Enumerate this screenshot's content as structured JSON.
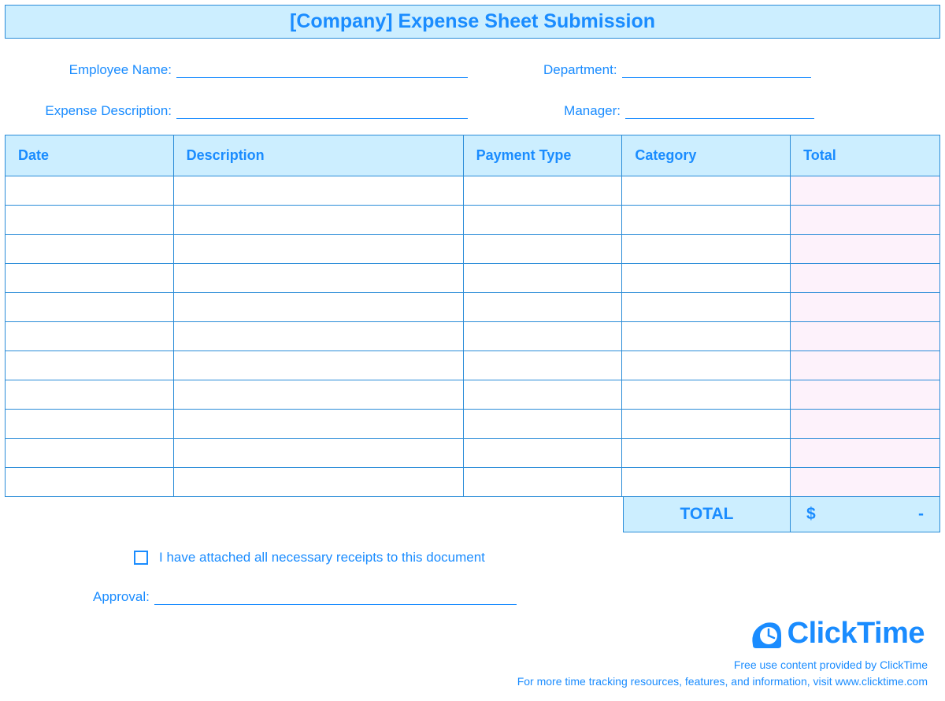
{
  "title": "[Company] Expense Sheet Submission",
  "info": {
    "employee_name_label": "Employee Name:",
    "employee_name_value": "",
    "department_label": "Department:",
    "department_value": "",
    "expense_desc_label": "Expense Description:",
    "expense_desc_value": "",
    "manager_label": "Manager:",
    "manager_value": ""
  },
  "columns": {
    "date": "Date",
    "description": "Description",
    "payment_type": "Payment Type",
    "category": "Category",
    "total": "Total"
  },
  "rows": [
    {
      "date": "",
      "description": "",
      "payment_type": "",
      "category": "",
      "total": ""
    },
    {
      "date": "",
      "description": "",
      "payment_type": "",
      "category": "",
      "total": ""
    },
    {
      "date": "",
      "description": "",
      "payment_type": "",
      "category": "",
      "total": ""
    },
    {
      "date": "",
      "description": "",
      "payment_type": "",
      "category": "",
      "total": ""
    },
    {
      "date": "",
      "description": "",
      "payment_type": "",
      "category": "",
      "total": ""
    },
    {
      "date": "",
      "description": "",
      "payment_type": "",
      "category": "",
      "total": ""
    },
    {
      "date": "",
      "description": "",
      "payment_type": "",
      "category": "",
      "total": ""
    },
    {
      "date": "",
      "description": "",
      "payment_type": "",
      "category": "",
      "total": ""
    },
    {
      "date": "",
      "description": "",
      "payment_type": "",
      "category": "",
      "total": ""
    },
    {
      "date": "",
      "description": "",
      "payment_type": "",
      "category": "",
      "total": ""
    },
    {
      "date": "",
      "description": "",
      "payment_type": "",
      "category": "",
      "total": ""
    }
  ],
  "summary": {
    "total_label": "TOTAL",
    "currency_symbol": "$",
    "total_value": "-"
  },
  "attestation": {
    "checked": false,
    "text": "I have attached all necessary receipts to this document"
  },
  "approval": {
    "label": "Approval:",
    "value": ""
  },
  "brand": {
    "name": "ClickTime"
  },
  "footer": {
    "line1": "Free use content provided by ClickTime",
    "line2": "For more time tracking resources, features, and information, visit www.clicktime.com"
  }
}
